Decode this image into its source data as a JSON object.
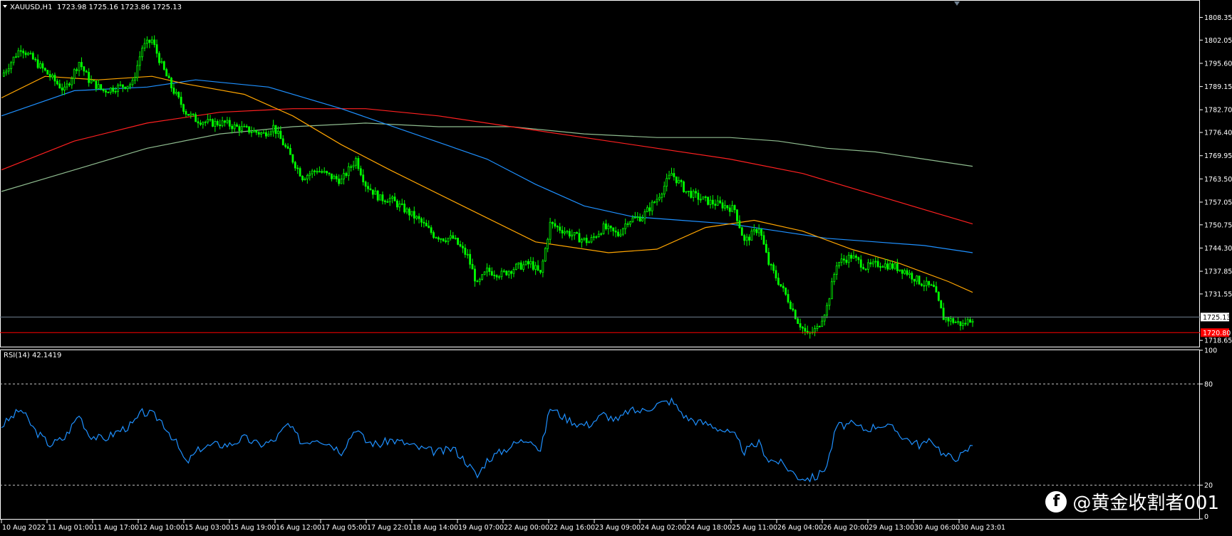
{
  "header": {
    "symbol": "XAUUSD,H1",
    "ohlc": "1723.98 1725.16 1723.86 1725.13",
    "rsi_label": "RSI(14) 42.1419"
  },
  "watermark": {
    "icon": "facebook-logo-icon",
    "text": "@黄金收割者001"
  },
  "colors": {
    "background": "#000000",
    "candle": "#00ff00",
    "ma_fast": "#ffa500",
    "ma_mid": "#1e90ff",
    "ma_slow": "#ff2020",
    "ma_long": "#8fbc8f",
    "rsi": "#1e90ff",
    "bid_line": "#708090",
    "price_line": "#ff0000",
    "axis": "#ffffff"
  },
  "chart_data": [
    {
      "type": "candlestick",
      "title": "XAUUSD,H1",
      "y_ticks": [
        "1808.35",
        "1802.05",
        "1795.60",
        "1789.15",
        "1782.70",
        "1776.40",
        "1769.95",
        "1763.50",
        "1757.05",
        "1750.75",
        "1744.30",
        "1737.85",
        "1731.55",
        "1718.65"
      ],
      "ylim": [
        1717.5,
        1812
      ],
      "current_price_label": "1725.13",
      "red_line_label": "1720.80",
      "x_labels": [
        "10 Aug 2022",
        "11 Aug 01:00",
        "11 Aug 17:00",
        "12 Aug 10:00",
        "15 Aug 03:00",
        "15 Aug 19:00",
        "16 Aug 12:00",
        "17 Aug 05:00",
        "17 Aug 22:01",
        "18 Aug 14:00",
        "19 Aug 07:00",
        "22 Aug 00:00",
        "22 Aug 16:00",
        "23 Aug 09:00",
        "24 Aug 02:00",
        "24 Aug 18:00",
        "25 Aug 11:00",
        "26 Aug 04:00",
        "26 Aug 20:00",
        "29 Aug 13:00",
        "30 Aug 06:00",
        "30 Aug 23:01"
      ],
      "close_trace": [
        [
          0,
          1792
        ],
        [
          8,
          1800
        ],
        [
          14,
          1796
        ],
        [
          20,
          1792
        ],
        [
          26,
          1788
        ],
        [
          32,
          1796
        ],
        [
          36,
          1791
        ],
        [
          42,
          1788
        ],
        [
          48,
          1789
        ],
        [
          54,
          1790
        ],
        [
          58,
          1800
        ],
        [
          62,
          1802
        ],
        [
          66,
          1795
        ],
        [
          70,
          1789
        ],
        [
          76,
          1782
        ],
        [
          80,
          1780
        ],
        [
          86,
          1779
        ],
        [
          92,
          1779
        ],
        [
          96,
          1778
        ],
        [
          102,
          1777
        ],
        [
          108,
          1776
        ],
        [
          112,
          1778
        ],
        [
          118,
          1771
        ],
        [
          124,
          1764
        ],
        [
          130,
          1766
        ],
        [
          136,
          1764
        ],
        [
          140,
          1763
        ],
        [
          146,
          1769
        ],
        [
          150,
          1762
        ],
        [
          156,
          1758
        ],
        [
          160,
          1758
        ],
        [
          166,
          1755
        ],
        [
          172,
          1752
        ],
        [
          178,
          1748
        ],
        [
          182,
          1747
        ],
        [
          186,
          1747
        ],
        [
          192,
          1742
        ],
        [
          196,
          1734
        ],
        [
          200,
          1738
        ],
        [
          206,
          1737
        ],
        [
          212,
          1739
        ],
        [
          218,
          1740
        ],
        [
          222,
          1737
        ],
        [
          226,
          1751
        ],
        [
          232,
          1749
        ],
        [
          238,
          1747
        ],
        [
          242,
          1746
        ],
        [
          248,
          1750
        ],
        [
          254,
          1748
        ],
        [
          258,
          1752
        ],
        [
          264,
          1753
        ],
        [
          270,
          1758
        ],
        [
          276,
          1765
        ],
        [
          282,
          1760
        ],
        [
          288,
          1758
        ],
        [
          292,
          1757
        ],
        [
          298,
          1756
        ],
        [
          302,
          1755
        ],
        [
          306,
          1746
        ],
        [
          312,
          1750
        ],
        [
          316,
          1740
        ],
        [
          320,
          1735
        ],
        [
          324,
          1730
        ],
        [
          328,
          1724
        ],
        [
          332,
          1720
        ],
        [
          336,
          1722
        ],
        [
          340,
          1728
        ],
        [
          344,
          1740
        ],
        [
          350,
          1742
        ],
        [
          356,
          1739
        ],
        [
          362,
          1740
        ],
        [
          368,
          1739
        ],
        [
          372,
          1738
        ],
        [
          378,
          1735
        ],
        [
          384,
          1733
        ],
        [
          388,
          1725
        ],
        [
          392,
          1724
        ],
        [
          396,
          1723
        ],
        [
          400,
          1725
        ]
      ],
      "ma_fast": [
        [
          0,
          1786
        ],
        [
          18,
          1792
        ],
        [
          40,
          1791
        ],
        [
          62,
          1792
        ],
        [
          75,
          1790
        ],
        [
          100,
          1787
        ],
        [
          120,
          1781
        ],
        [
          140,
          1773
        ],
        [
          160,
          1766
        ],
        [
          190,
          1756
        ],
        [
          220,
          1746
        ],
        [
          250,
          1743
        ],
        [
          270,
          1744
        ],
        [
          290,
          1750
        ],
        [
          310,
          1752
        ],
        [
          330,
          1749
        ],
        [
          350,
          1744
        ],
        [
          370,
          1740
        ],
        [
          390,
          1735
        ],
        [
          400,
          1732
        ]
      ],
      "ma_mid": [
        [
          0,
          1781
        ],
        [
          30,
          1788
        ],
        [
          60,
          1789
        ],
        [
          80,
          1791
        ],
        [
          110,
          1789
        ],
        [
          140,
          1783
        ],
        [
          170,
          1776
        ],
        [
          200,
          1769
        ],
        [
          220,
          1762
        ],
        [
          240,
          1756
        ],
        [
          260,
          1753
        ],
        [
          280,
          1752
        ],
        [
          300,
          1751
        ],
        [
          320,
          1749
        ],
        [
          340,
          1747
        ],
        [
          360,
          1746
        ],
        [
          380,
          1745
        ],
        [
          400,
          1743
        ]
      ],
      "ma_slow": [
        [
          0,
          1766
        ],
        [
          30,
          1774
        ],
        [
          60,
          1779
        ],
        [
          90,
          1782
        ],
        [
          120,
          1783
        ],
        [
          150,
          1783
        ],
        [
          180,
          1781
        ],
        [
          210,
          1778
        ],
        [
          240,
          1775
        ],
        [
          270,
          1772
        ],
        [
          300,
          1769
        ],
        [
          330,
          1765
        ],
        [
          360,
          1759
        ],
        [
          385,
          1754
        ],
        [
          400,
          1751
        ]
      ],
      "ma_long": [
        [
          0,
          1760
        ],
        [
          30,
          1766
        ],
        [
          60,
          1772
        ],
        [
          90,
          1776
        ],
        [
          120,
          1778
        ],
        [
          150,
          1779
        ],
        [
          180,
          1778
        ],
        [
          210,
          1778
        ],
        [
          240,
          1776
        ],
        [
          270,
          1775
        ],
        [
          300,
          1775
        ],
        [
          320,
          1774
        ],
        [
          340,
          1772
        ],
        [
          360,
          1771
        ],
        [
          380,
          1769
        ],
        [
          400,
          1767
        ]
      ]
    },
    {
      "type": "line",
      "title": "RSI(14) 42.1419",
      "y_ticks": [
        "100",
        "80",
        "20",
        "0"
      ],
      "ylim": [
        0,
        100
      ],
      "levels": [
        80,
        20
      ],
      "series": [
        {
          "name": "RSI(14)",
          "values": [
            [
              0,
              55
            ],
            [
              4,
              60
            ],
            [
              8,
              65
            ],
            [
              14,
              52
            ],
            [
              20,
              44
            ],
            [
              26,
              48
            ],
            [
              32,
              62
            ],
            [
              36,
              50
            ],
            [
              42,
              47
            ],
            [
              48,
              52
            ],
            [
              54,
              56
            ],
            [
              58,
              63
            ],
            [
              62,
              62
            ],
            [
              66,
              58
            ],
            [
              72,
              45
            ],
            [
              76,
              33
            ],
            [
              82,
              42
            ],
            [
              88,
              44
            ],
            [
              94,
              44
            ],
            [
              100,
              48
            ],
            [
              106,
              44
            ],
            [
              112,
              46
            ],
            [
              118,
              56
            ],
            [
              124,
              45
            ],
            [
              130,
              48
            ],
            [
              136,
              44
            ],
            [
              140,
              40
            ],
            [
              146,
              54
            ],
            [
              150,
              46
            ],
            [
              156,
              44
            ],
            [
              160,
              47
            ],
            [
              166,
              45
            ],
            [
              172,
              42
            ],
            [
              178,
              40
            ],
            [
              182,
              40
            ],
            [
              186,
              42
            ],
            [
              192,
              33
            ],
            [
              196,
              25
            ],
            [
              200,
              35
            ],
            [
              206,
              40
            ],
            [
              212,
              45
            ],
            [
              218,
              48
            ],
            [
              222,
              40
            ],
            [
              226,
              66
            ],
            [
              232,
              60
            ],
            [
              238,
              56
            ],
            [
              242,
              56
            ],
            [
              248,
              62
            ],
            [
              254,
              58
            ],
            [
              258,
              64
            ],
            [
              264,
              64
            ],
            [
              270,
              68
            ],
            [
              276,
              70
            ],
            [
              282,
              60
            ],
            [
              288,
              57
            ],
            [
              292,
              56
            ],
            [
              298,
              52
            ],
            [
              302,
              49
            ],
            [
              306,
              40
            ],
            [
              312,
              45
            ],
            [
              316,
              35
            ],
            [
              320,
              34
            ],
            [
              324,
              30
            ],
            [
              328,
              25
            ],
            [
              332,
              24
            ],
            [
              336,
              25
            ],
            [
              340,
              32
            ],
            [
              344,
              55
            ],
            [
              350,
              56
            ],
            [
              356,
              53
            ],
            [
              362,
              56
            ],
            [
              368,
              53
            ],
            [
              372,
              48
            ],
            [
              378,
              44
            ],
            [
              384,
              46
            ],
            [
              388,
              38
            ],
            [
              392,
              36
            ],
            [
              396,
              38
            ],
            [
              400,
              44
            ]
          ]
        }
      ]
    }
  ]
}
